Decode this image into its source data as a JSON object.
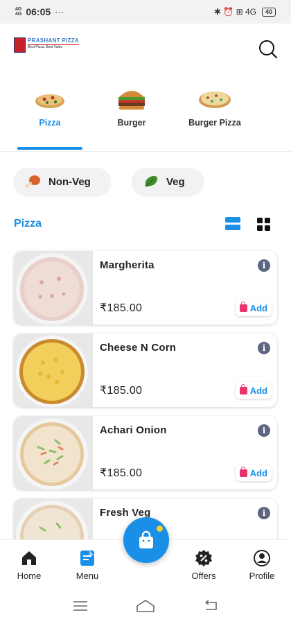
{
  "status_bar": {
    "signal_top": "4G",
    "signal_bottom": "4G",
    "time": "06:05",
    "dots": "···",
    "right_icons": "✱ ⏰ ⊞ 4G",
    "battery": "40"
  },
  "header": {
    "logo_line1": "PRASHANT PIZZA",
    "logo_line2": "Best Pizza, Best Value"
  },
  "categories": [
    {
      "label": "Pizza",
      "icon": "pizza-icon",
      "active": true
    },
    {
      "label": "Burger",
      "icon": "burger-icon",
      "active": false
    },
    {
      "label": "Burger Pizza",
      "icon": "burger-pizza-icon",
      "active": false
    }
  ],
  "filters": {
    "nonveg": "Non-Veg",
    "veg": "Veg"
  },
  "section": {
    "title": "Pizza"
  },
  "products": [
    {
      "name": "Margherita",
      "price": "₹185.00",
      "add": "Add"
    },
    {
      "name": "Cheese N Corn",
      "price": "₹185.00",
      "add": "Add"
    },
    {
      "name": "Achari Onion",
      "price": "₹185.00",
      "add": "Add"
    },
    {
      "name": "Fresh Veg",
      "price": "",
      "add": ""
    }
  ],
  "nav": {
    "home": "Home",
    "menu": "Menu",
    "offers": "Offers",
    "profile": "Profile"
  },
  "colors": {
    "accent": "#1a8fe8",
    "bag": "#e8336e",
    "badge": "#f6d12c"
  }
}
